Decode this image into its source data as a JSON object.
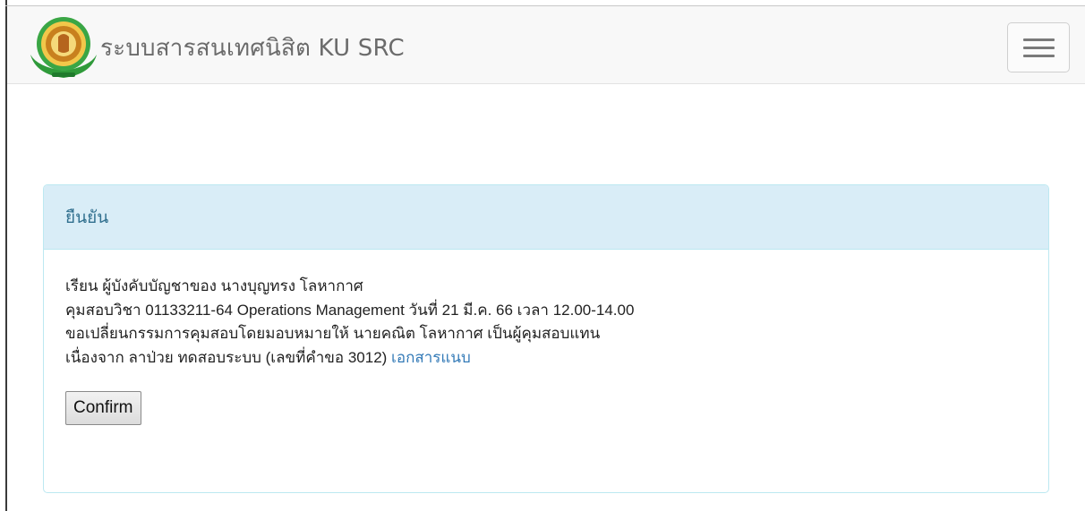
{
  "navbar": {
    "brand": "ระบบสารสนเทศนิสิต KU SRC",
    "logo_icon": "ku-emblem-icon",
    "toggle_icon": "hamburger-menu-icon"
  },
  "panel": {
    "heading": "ยืนยัน",
    "lines": [
      "เรียน ผู้บังคับบัญชาของ นางบุญทรง โลหากาศ",
      "คุมสอบวิชา 01133211-64 Operations Management วันที่ 21 มี.ค. 66 เวลา 12.00-14.00",
      "ขอเปลี่ยนกรรมการคุมสอบโดยมอบหมายให้ นายคณิต โลหากาศ เป็นผู้คุมสอบแทน",
      "เนื่องจาก ลาป่วย ทดสอบระบบ (เลขที่คำขอ 3012)"
    ],
    "attachment_link": "เอกสารแนบ",
    "confirm_label": "Confirm"
  },
  "colors": {
    "panel_heading_bg": "#d9edf7",
    "panel_heading_text": "#31708f",
    "panel_border": "#bce8f1",
    "link": "#337ab7",
    "navbar_bg": "#f8f8f8"
  }
}
